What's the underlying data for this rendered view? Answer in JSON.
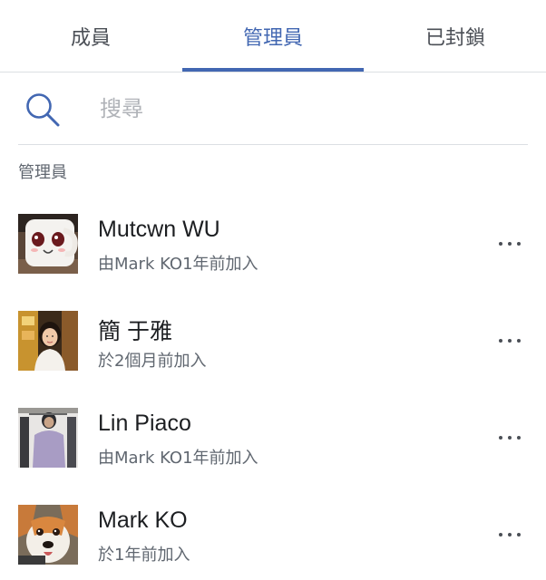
{
  "tabs": [
    {
      "label": "成員",
      "active": false
    },
    {
      "label": "管理員",
      "active": true
    },
    {
      "label": "已封鎖",
      "active": false
    }
  ],
  "search": {
    "placeholder": "搜尋",
    "value": ""
  },
  "section": {
    "title": "管理員"
  },
  "members": [
    {
      "name": "Mutcwn WU",
      "subtitle": "由Mark KO1年前加入",
      "avatar": "white-cartoon-mug-avatar"
    },
    {
      "name": "簡 于雅",
      "subtitle": "於2個月前加入",
      "avatar": "woman-portrait-avatar"
    },
    {
      "name": "Lin Piaco",
      "subtitle": "由Mark KO1年前加入",
      "avatar": "clothing-rack-avatar"
    },
    {
      "name": "Mark KO",
      "subtitle": "於1年前加入",
      "avatar": "corgi-dog-avatar"
    }
  ],
  "colors": {
    "accent": "#4267b2",
    "text_primary": "#1c1e21",
    "text_secondary": "#606770",
    "divider": "#dcdfe3"
  }
}
